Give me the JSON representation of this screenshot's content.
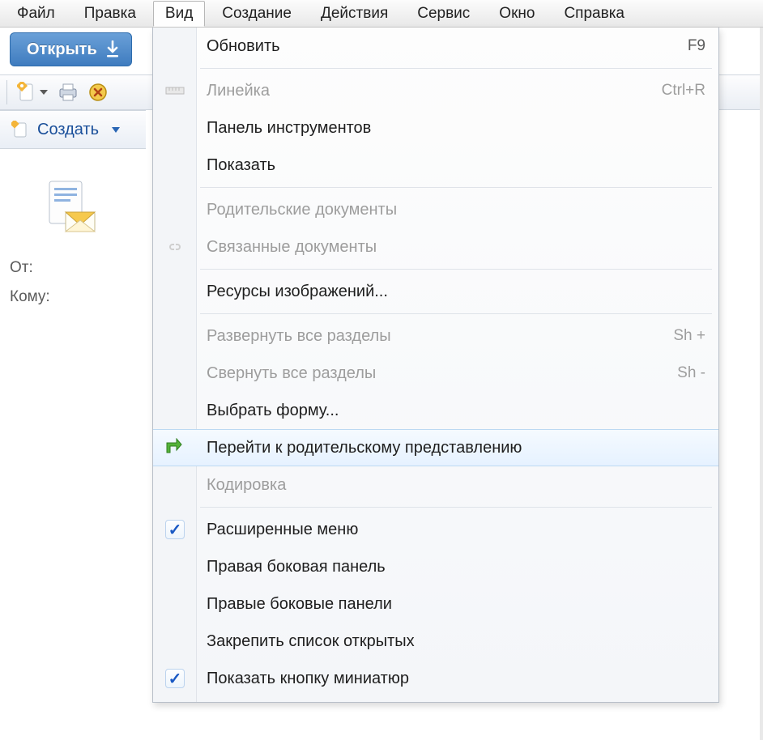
{
  "menubar": {
    "file": "Файл",
    "edit": "Правка",
    "view": "Вид",
    "create": "Создание",
    "actions": "Действия",
    "tools": "Сервис",
    "window": "Окно",
    "help": "Справка"
  },
  "open_button": {
    "label": "Открыть"
  },
  "sidebar": {
    "create_label": "Создать",
    "from_label": "От:",
    "to_label": "Кому:"
  },
  "menu_view": {
    "refresh": {
      "label": "Обновить",
      "shortcut": "F9"
    },
    "ruler": {
      "label": "Линейка",
      "shortcut": "Ctrl+R"
    },
    "toolbars": {
      "label": "Панель инструментов"
    },
    "show": {
      "label": "Показать"
    },
    "parent_docs": {
      "label": "Родительские документы"
    },
    "linked_docs": {
      "label": "Связанные документы"
    },
    "image_res": {
      "label": "Ресурсы изображений..."
    },
    "expand_all": {
      "label": "Развернуть все разделы",
      "shortcut": "Sh +"
    },
    "collapse_all": {
      "label": "Свернуть все разделы",
      "shortcut": "Sh -"
    },
    "select_form": {
      "label": "Выбрать форму..."
    },
    "go_parent_view": {
      "label": "Перейти к родительскому представлению"
    },
    "encoding": {
      "label": "Кодировка"
    },
    "extended_menus": {
      "label": "Расширенные меню"
    },
    "right_panel": {
      "label": "Правая боковая панель"
    },
    "right_panels": {
      "label": "Правые боковые панели"
    },
    "pin_open_list": {
      "label": "Закрепить список открытых"
    },
    "show_thumb_btn": {
      "label": "Показать кнопку миниатюр"
    }
  }
}
